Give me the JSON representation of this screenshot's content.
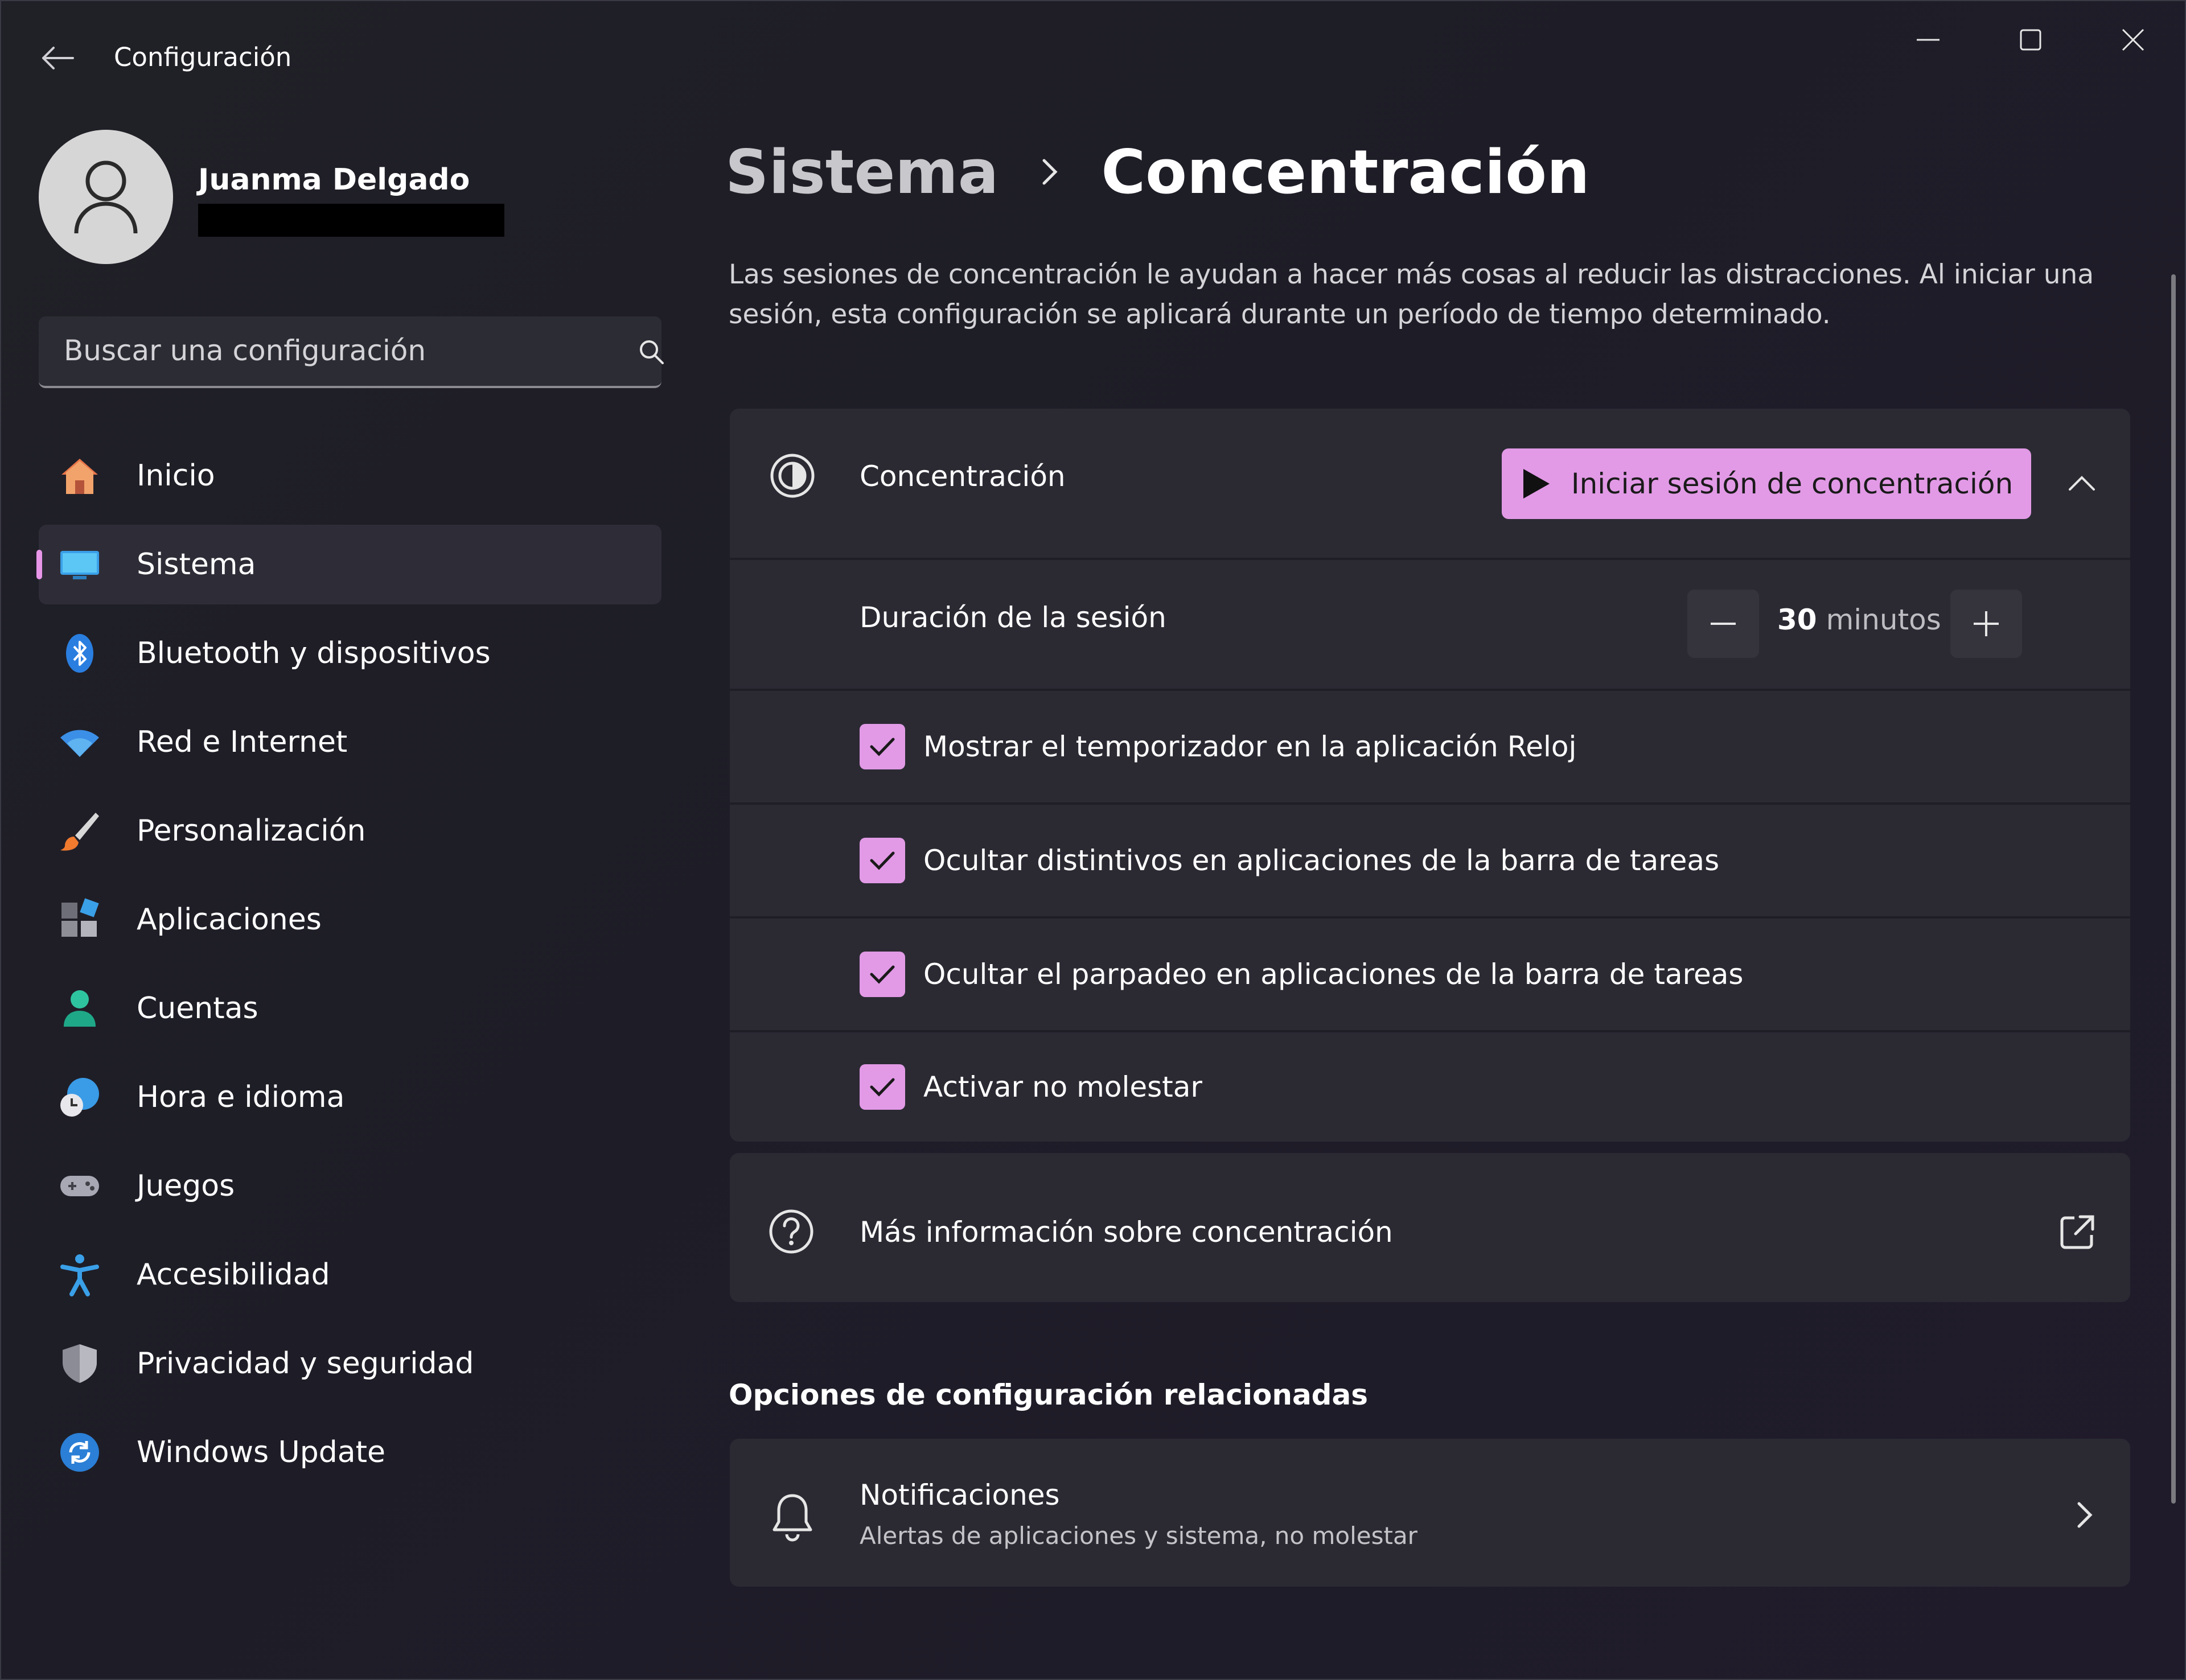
{
  "window": {
    "title": "Configuración"
  },
  "profile": {
    "name": "Juanma Delgado"
  },
  "search": {
    "placeholder": "Buscar una configuración"
  },
  "sidebar": {
    "items": [
      {
        "label": "Inicio",
        "icon": "home-icon"
      },
      {
        "label": "Sistema",
        "icon": "monitor-icon",
        "active": true
      },
      {
        "label": "Bluetooth y dispositivos",
        "icon": "bluetooth-icon"
      },
      {
        "label": "Red e Internet",
        "icon": "wifi-icon"
      },
      {
        "label": "Personalización",
        "icon": "brush-icon"
      },
      {
        "label": "Aplicaciones",
        "icon": "apps-icon"
      },
      {
        "label": "Cuentas",
        "icon": "person-icon"
      },
      {
        "label": "Hora e idioma",
        "icon": "globe-clock-icon"
      },
      {
        "label": "Juegos",
        "icon": "gamepad-icon"
      },
      {
        "label": "Accesibilidad",
        "icon": "accessibility-icon"
      },
      {
        "label": "Privacidad y seguridad",
        "icon": "shield-icon"
      },
      {
        "label": "Windows Update",
        "icon": "update-icon"
      }
    ]
  },
  "breadcrumb": {
    "parent": "Sistema",
    "current": "Concentración"
  },
  "description": "Las sesiones de concentración le ayudan a hacer más cosas al reducir las distracciones. Al iniciar una sesión, esta configuración se aplicará durante un período de tiempo determinado.",
  "focus_card": {
    "label": "Concentración",
    "start_button": "Iniciar sesión de concentración",
    "duration_label": "Duración de la sesión",
    "duration_value": "30",
    "duration_unit": "minutos",
    "options": [
      {
        "label": "Mostrar el temporizador en la aplicación Reloj",
        "checked": true
      },
      {
        "label": "Ocultar distintivos en aplicaciones de la barra de tareas",
        "checked": true
      },
      {
        "label": "Ocultar el parpadeo en aplicaciones de la barra de tareas",
        "checked": true
      },
      {
        "label": "Activar no molestar",
        "checked": true
      }
    ]
  },
  "info_card": {
    "label": "Más información sobre concentración"
  },
  "related": {
    "title": "Opciones de configuración relacionadas",
    "notifications_title": "Notificaciones",
    "notifications_subtitle": "Alertas de aplicaciones y sistema, no molestar"
  },
  "colors": {
    "accent": "#e29ae6",
    "card": "#2b2a33",
    "background": "#1e1d27"
  }
}
